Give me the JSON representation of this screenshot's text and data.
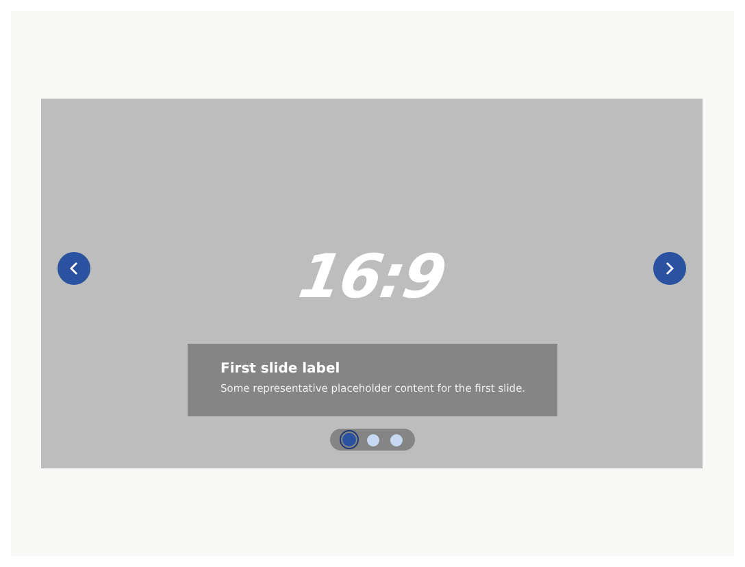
{
  "slide": {
    "ratio_text": "16:9",
    "caption": {
      "title": "First slide label",
      "text": "Some representative placeholder content for the first slide."
    }
  },
  "indicators": [
    {
      "selected": true
    },
    {
      "selected": false
    },
    {
      "selected": false
    }
  ]
}
